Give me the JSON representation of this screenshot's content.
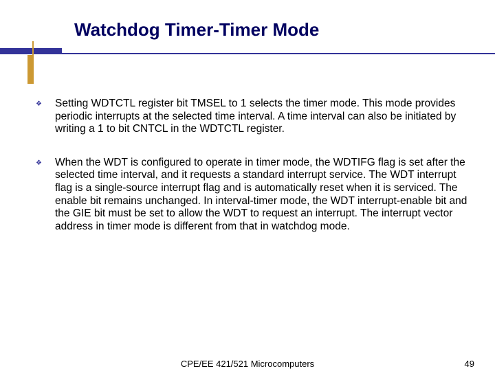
{
  "title": "Watchdog Timer-Timer Mode",
  "bullets": [
    "Setting WDTCTL register bit TMSEL to 1 selects the timer mode. This mode provides periodic interrupts at the selected time interval. A time interval can also be initiated by writing a 1 to bit CNTCL in the WDTCTL register.",
    "When the WDT is configured to operate in timer mode, the WDTIFG flag is set after the selected time interval, and it requests a standard interrupt service. The WDT interrupt flag is a single-source interrupt flag and is automatically reset when it is serviced. The enable bit remains unchanged. In interval-timer mode, the WDT interrupt-enable bit and the GIE bit must be set to allow the WDT to request an interrupt. The interrupt vector address in timer mode is different from that in watchdog mode."
  ],
  "footer": {
    "course": "CPE/EE 421/521 Microcomputers",
    "page": "49"
  }
}
